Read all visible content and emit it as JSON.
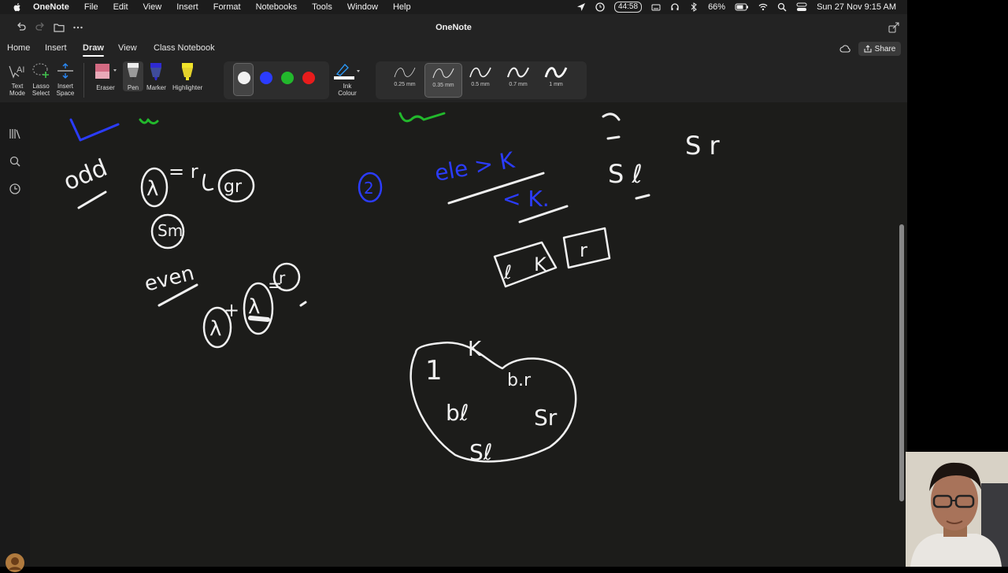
{
  "menubar": {
    "app_name": "OneNote",
    "menus": [
      "File",
      "Edit",
      "View",
      "Insert",
      "Format",
      "Notebooks",
      "Tools",
      "Window",
      "Help"
    ],
    "timer": "44:58",
    "battery": "66%",
    "datetime": "Sun 27 Nov  9:15 AM"
  },
  "window": {
    "title": "OneNote"
  },
  "tabs": [
    "Home",
    "Insert",
    "Draw",
    "View",
    "Class Notebook"
  ],
  "active_tab": "Draw",
  "share_label": "Share",
  "ribbon": {
    "text_mode": "Text\nMode",
    "lasso_select": "Lasso\nSelect",
    "insert_space": "Insert\nSpace",
    "eraser": "Eraser",
    "pen": "Pen",
    "marker": "Marker",
    "highlighter": "Highlighter",
    "ink_colour": "Ink\nColour",
    "pen_colors": [
      "#f2f2f2",
      "#2b3cff",
      "#22b82c",
      "#e81c1c"
    ],
    "thickness": [
      "0.25 mm",
      "0.35 mm",
      "0.5 mm",
      "0.7 mm",
      "1 mm"
    ],
    "selected_thickness": "0.35 mm"
  },
  "ink": {
    "odd": "odd",
    "even": "even",
    "ele_gt_k": "ele > K",
    "lt_k": "< K.",
    "sl": "S ℓ",
    "sr": "S r",
    "box_l": "ℓ",
    "box_k": "K",
    "box_r": "r",
    "circle_2": "2",
    "blob_1": "1",
    "blob_k": "K",
    "blob_br": "b.r",
    "blob_bl": "bℓ",
    "blob_sr": "Sr",
    "blob_sl": "Sℓ",
    "lambda_eq_r": "= r",
    "gr": "gr",
    "sm": "Sm"
  }
}
